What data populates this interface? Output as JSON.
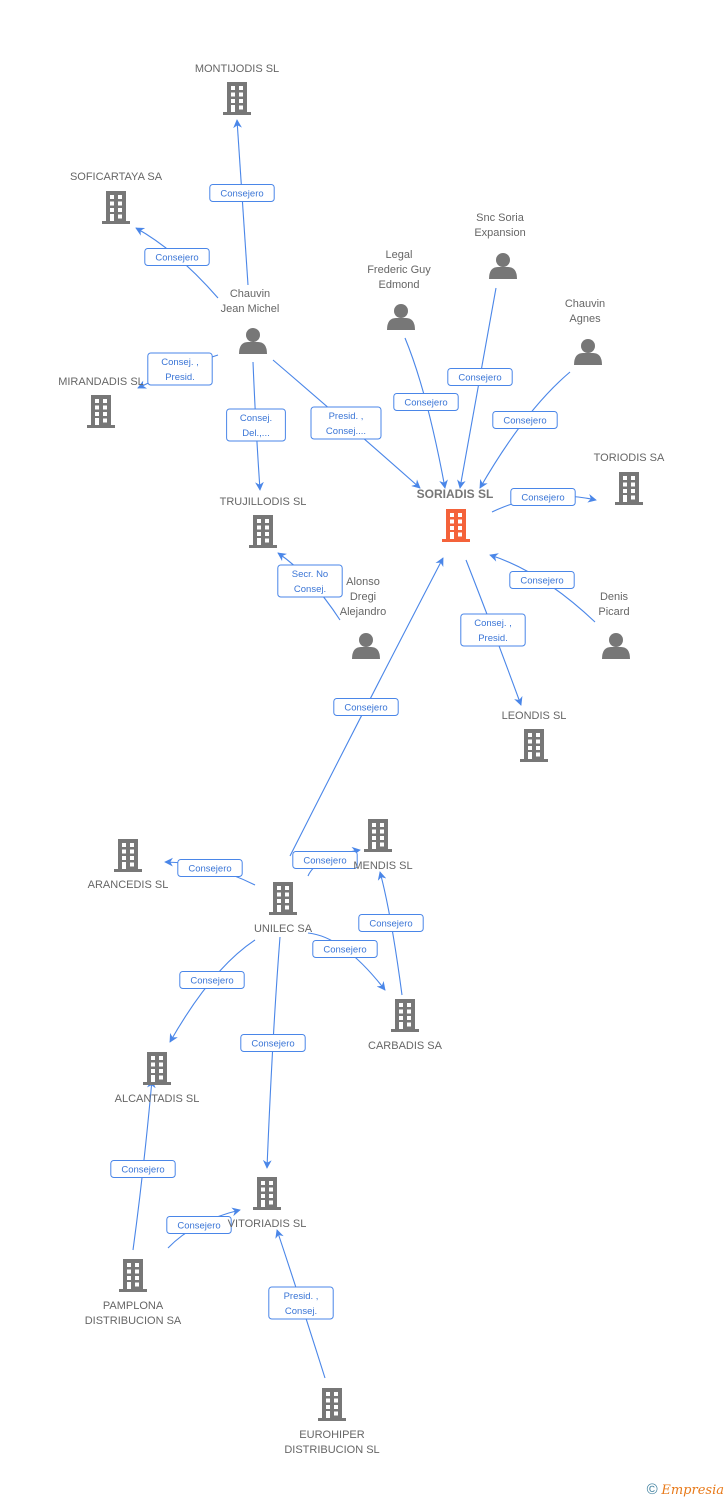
{
  "colors": {
    "edge": "#4a86e8",
    "node": "#777777",
    "main_node": "#f4623a"
  },
  "nodes": [
    {
      "id": "montijodis",
      "label": [
        "MONTIJODIS SL"
      ],
      "type": "company"
    },
    {
      "id": "soficartaya",
      "label": [
        "SOFICARTAYA SA"
      ],
      "type": "company"
    },
    {
      "id": "chauvin_jm",
      "label": [
        "Chauvin",
        "Jean Michel"
      ],
      "type": "person"
    },
    {
      "id": "mirandadis",
      "label": [
        "MIRANDADIS SL"
      ],
      "type": "company"
    },
    {
      "id": "trujillodis",
      "label": [
        "TRUJILLODIS SL"
      ],
      "type": "company"
    },
    {
      "id": "legal",
      "label": [
        "Legal",
        "Frederic Guy",
        "Edmond"
      ],
      "type": "person"
    },
    {
      "id": "snc",
      "label": [
        "Snc Soria",
        "Expansion"
      ],
      "type": "person"
    },
    {
      "id": "chauvin_a",
      "label": [
        "Chauvin",
        "Agnes"
      ],
      "type": "person"
    },
    {
      "id": "soriadis",
      "label": [
        "SORIADIS SL"
      ],
      "type": "company",
      "main": true
    },
    {
      "id": "toriodis",
      "label": [
        "TORIODIS SA"
      ],
      "type": "company"
    },
    {
      "id": "alonso",
      "label": [
        "Alonso",
        "Dregi",
        "Alejandro"
      ],
      "type": "person"
    },
    {
      "id": "denis",
      "label": [
        "Denis",
        "Picard"
      ],
      "type": "person"
    },
    {
      "id": "leondis",
      "label": [
        "LEONDIS SL"
      ],
      "type": "company"
    },
    {
      "id": "mendis",
      "label": [
        "MENDIS SL"
      ],
      "type": "company"
    },
    {
      "id": "arancedis",
      "label": [
        "ARANCEDIS SL"
      ],
      "type": "company"
    },
    {
      "id": "unilec",
      "label": [
        "UNILEC SA"
      ],
      "type": "company"
    },
    {
      "id": "carbadis",
      "label": [
        "CARBADIS SA"
      ],
      "type": "company"
    },
    {
      "id": "alcantadis",
      "label": [
        "ALCANTADIS SL"
      ],
      "type": "company"
    },
    {
      "id": "vitoriadis",
      "label": [
        "VITORIADIS SL"
      ],
      "type": "company"
    },
    {
      "id": "pamplona",
      "label": [
        "PAMPLONA",
        "DISTRIBUCION SA"
      ],
      "type": "company"
    },
    {
      "id": "eurohiper",
      "label": [
        "EUROHIPER",
        "DISTRIBUCION SL"
      ],
      "type": "company"
    }
  ],
  "edges": [
    {
      "from": "chauvin_jm",
      "to": "montijodis",
      "label": [
        "Consejero"
      ]
    },
    {
      "from": "chauvin_jm",
      "to": "soficartaya",
      "label": [
        "Consejero"
      ]
    },
    {
      "from": "chauvin_jm",
      "to": "mirandadis",
      "label": [
        "Consej. ,",
        "Presid."
      ]
    },
    {
      "from": "chauvin_jm",
      "to": "trujillodis",
      "label": [
        "Consej.",
        "Del.,..."
      ]
    },
    {
      "from": "chauvin_jm",
      "to": "soriadis",
      "label": [
        "Presid. ,",
        "Consej...."
      ]
    },
    {
      "from": "legal",
      "to": "soriadis",
      "label": [
        "Consejero"
      ]
    },
    {
      "from": "snc",
      "to": "soriadis",
      "label": [
        "Consejero"
      ]
    },
    {
      "from": "chauvin_a",
      "to": "soriadis",
      "label": [
        "Consejero"
      ]
    },
    {
      "from": "soriadis",
      "to": "toriodis",
      "label": [
        "Consejero"
      ]
    },
    {
      "from": "alonso",
      "to": "trujillodis",
      "label": [
        "Secr.  No",
        "Consej."
      ]
    },
    {
      "from": "denis",
      "to": "soriadis",
      "label": [
        "Consejero"
      ]
    },
    {
      "from": "soriadis",
      "to": "leondis",
      "label": [
        "Consej. ,",
        "Presid."
      ]
    },
    {
      "from": "unilec",
      "to": "soriadis",
      "label": [
        "Consejero"
      ]
    },
    {
      "from": "unilec",
      "to": "arancedis",
      "label": [
        "Consejero"
      ]
    },
    {
      "from": "unilec",
      "to": "mendis",
      "label": [
        "Consejero"
      ]
    },
    {
      "from": "carbadis",
      "to": "mendis",
      "label": [
        "Consejero"
      ]
    },
    {
      "from": "unilec",
      "to": "carbadis",
      "label": [
        "Consejero"
      ]
    },
    {
      "from": "unilec",
      "to": "alcantadis",
      "label": [
        "Consejero"
      ]
    },
    {
      "from": "unilec",
      "to": "vitoriadis",
      "label": [
        "Consejero"
      ]
    },
    {
      "from": "pamplona",
      "to": "alcantadis",
      "label": [
        "Consejero"
      ]
    },
    {
      "from": "pamplona",
      "to": "vitoriadis",
      "label": [
        "Consejero"
      ]
    },
    {
      "from": "eurohiper",
      "to": "vitoriadis",
      "label": [
        "Presid. ,",
        "Consej."
      ]
    }
  ],
  "footer": {
    "copyright": "©",
    "brand": "Empresia"
  }
}
